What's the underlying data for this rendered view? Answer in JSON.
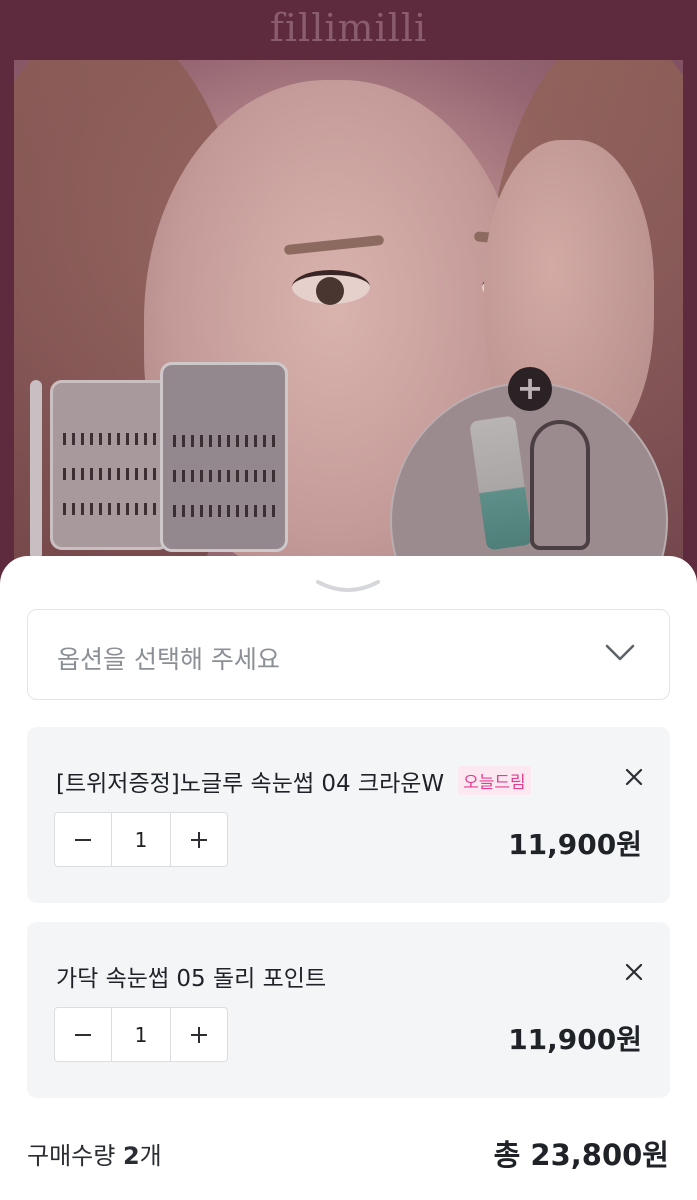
{
  "background": {
    "brand_logo": "fillimilli",
    "promo_plus": "+",
    "colors": {
      "overlay": "#5e2a3e",
      "accent_pink": "#e0418f"
    }
  },
  "option_select": {
    "placeholder": "옵션을 선택해 주세요",
    "icon": "chevron-down-icon"
  },
  "items": [
    {
      "name": "[트위저증정]노글루 속눈썹 04 크라운W",
      "badge": "오늘드림",
      "quantity": "1",
      "price": "11,900원",
      "minus": "−",
      "plus": "+"
    },
    {
      "name": "가닥 속눈썹 05 돌리 포인트",
      "quantity": "1",
      "price": "11,900원",
      "minus": "−",
      "plus": "+"
    }
  ],
  "summary": {
    "qty_label": "구매수량 ",
    "qty_value": "2",
    "qty_unit": "개",
    "total": "총 23,800원"
  }
}
